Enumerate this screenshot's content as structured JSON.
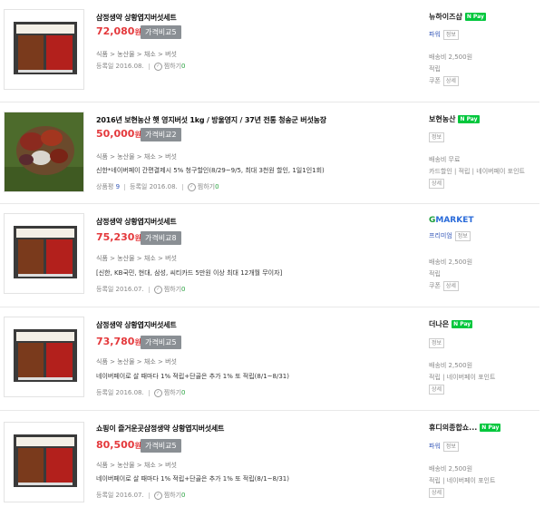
{
  "items": [
    {
      "title": "삼정생약 상황엽지버섯세트",
      "price": "72,080",
      "currency": "원",
      "compare": "가격비교5",
      "category": [
        "식품",
        "농산물",
        "채소",
        "버섯"
      ],
      "desc": "",
      "registered": "등록일 2016.08.",
      "zzim": "찜하기",
      "zzim_count": "0",
      "review_label": "",
      "review_count": "",
      "seller": "뉴하이즈샵",
      "npay": "N Pay",
      "grade": "파워",
      "grade_box": "정보",
      "ship": "배송비 2,500원",
      "ship2": "적립",
      "ship3": "쿠폰",
      "ship3_box": "상세"
    },
    {
      "title": "2016년 보현농산 햇 영지버섯 1kg / 방울영지 / 37년 전통 청송군 버섯농장",
      "price": "50,000",
      "currency": "원",
      "compare": "가격비교2",
      "category": [
        "식품",
        "농산물",
        "채소",
        "버섯"
      ],
      "desc": "신한*네이버페이 간편결제시 5% 청구할인(8/29~9/5, 최대 3천원 할인, 1일1인1회)",
      "registered": "등록일 2016.08.",
      "zzim": "찜하기",
      "zzim_count": "0",
      "review_label": "상품평",
      "review_count": "9",
      "seller": "보현농산",
      "npay": "N Pay",
      "grade": "",
      "grade_box": "정보",
      "ship": "배송비 무료",
      "ship2": "카드할인 | 적립 | 네이버페이 포인트",
      "ship3": "",
      "ship3_box": "상세"
    },
    {
      "title": "삼정생약 상황엽지버섯세트",
      "price": "75,230",
      "currency": "원",
      "compare": "가격비교8",
      "category": [
        "식품",
        "농산물",
        "채소",
        "버섯"
      ],
      "desc": "[신한, KB국민, 현대, 삼성, 씨티카드 5만원 이상 최대 12개월 무이자]",
      "registered": "등록일 2016.07.",
      "zzim": "찜하기",
      "zzim_count": "0",
      "review_label": "",
      "review_count": "",
      "seller": "GMARKET",
      "npay": "",
      "grade": "프리미엄",
      "grade_box": "정보",
      "ship": "배송비 2,500원",
      "ship2": "적립",
      "ship3": "쿠폰",
      "ship3_box": "상세"
    },
    {
      "title": "삼정생약 상황엽지버섯세트",
      "price": "73,780",
      "currency": "원",
      "compare": "가격비교5",
      "category": [
        "식품",
        "농산물",
        "채소",
        "버섯"
      ],
      "desc": "네이버페이로 살 때마다 1% 적립+단골은 추가 1% 또 적립(8/1~8/31)",
      "registered": "등록일 2016.08.",
      "zzim": "찜하기",
      "zzim_count": "0",
      "review_label": "",
      "review_count": "",
      "seller": "더나은",
      "npay": "N Pay",
      "grade": "",
      "grade_box": "정보",
      "ship": "배송비 2,500원",
      "ship2": "적립 | 네이버페이 포인트",
      "ship3": "",
      "ship3_box": "상세"
    },
    {
      "title": "쇼핑이 즐거운곳삼정생약 상황엽지버섯세트",
      "price": "80,500",
      "currency": "원",
      "compare": "가격비교5",
      "category": [
        "식품",
        "농산물",
        "채소",
        "버섯"
      ],
      "desc": "네이버페이로 살 때마다 1% 적립+단골은 추가 1% 또 적립(8/1~8/31)",
      "registered": "등록일 2016.07.",
      "zzim": "찜하기",
      "zzim_count": "0",
      "review_label": "",
      "review_count": "",
      "seller": "휴디의종합쇼...",
      "npay": "N Pay",
      "grade": "파워",
      "grade_box": "정보",
      "ship": "배송비 2,500원",
      "ship2": "적립 | 네이버페이 포인트",
      "ship3": "",
      "ship3_box": "상세"
    }
  ],
  "colors": {
    "price": "#e4393c",
    "npay": "#00c73c",
    "compare": "#8a8f94",
    "link": "#3558b8"
  }
}
